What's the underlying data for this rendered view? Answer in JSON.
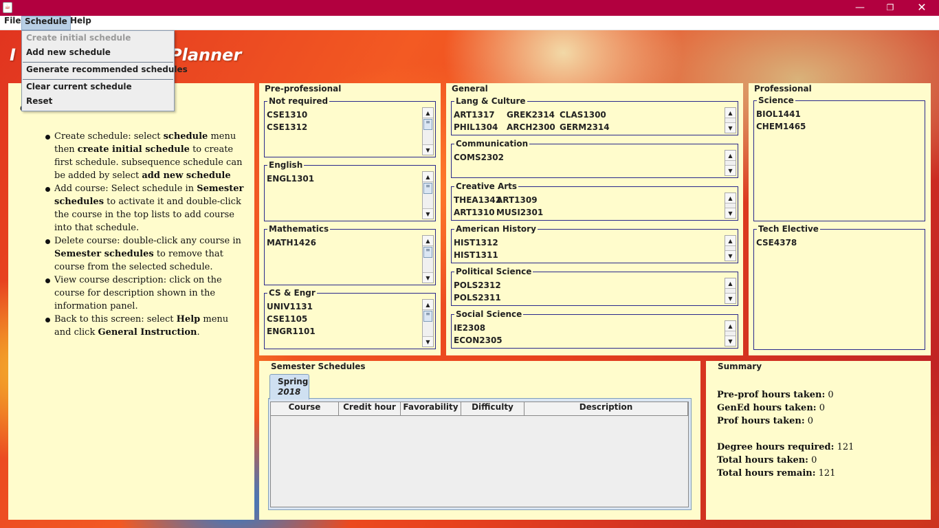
{
  "window": {
    "app_icon": "java-icon",
    "minimize_glyph": "—",
    "maximize_glyph": "❐",
    "close_glyph": "✕"
  },
  "menubar": {
    "file": "File",
    "schedule": "Schedule",
    "help": "Help"
  },
  "schedule_menu": {
    "create_initial": "Create initial schedule",
    "add_new": "Add new schedule",
    "generate_recommended": "Generate recommended schedules",
    "clear_current": "Clear current schedule",
    "reset": "Reset"
  },
  "banner": {
    "title_left": "I",
    "title_right": "Planner"
  },
  "instructions": {
    "heading": "General Instruction:",
    "items": [
      [
        "Create schedule: select ",
        "schedule",
        " menu then ",
        "create initial schedule",
        " to create first schedule. subsequence schedule can be added by select ",
        "add new schedule",
        ""
      ],
      [
        "Add course: Select schedule in ",
        "Semester schedules",
        " to activate it and double-click the course in the top lists to add course into that schedule.",
        "",
        "",
        "",
        ""
      ],
      [
        "Delete course: double-click any course in ",
        "Semester schedules",
        " to remove that course from the selected schedule.",
        "",
        "",
        "",
        ""
      ],
      [
        "View course description: click on the course for description shown in the information panel.",
        "",
        "",
        "",
        "",
        "",
        ""
      ],
      [
        "Back to this screen: select ",
        "Help",
        " menu and click ",
        "General Instruction",
        ".",
        "",
        ""
      ]
    ]
  },
  "preprofessional": {
    "title": "Pre-professional",
    "not_required": {
      "label": "Not required",
      "courses": [
        "CSE1310",
        "CSE1312"
      ]
    },
    "english": {
      "label": "English",
      "courses": [
        "ENGL1301"
      ]
    },
    "mathematics": {
      "label": "Mathematics",
      "courses": [
        "MATH1426"
      ]
    },
    "cs_engr": {
      "label": "CS & Engr",
      "courses": [
        "UNIV1131",
        "CSE1105",
        "ENGR1101"
      ]
    }
  },
  "general": {
    "title": "General",
    "lang_culture": {
      "label": "Lang & Culture",
      "rows": [
        [
          "ART1317",
          "GREK2314",
          "CLAS1300"
        ],
        [
          "PHIL1304",
          "ARCH2300",
          "GERM2314"
        ]
      ]
    },
    "communication": {
      "label": "Communication",
      "courses": [
        "COMS2302"
      ]
    },
    "creative_arts": {
      "label": "Creative Arts",
      "rows": [
        [
          "THEA1342",
          "ART1309"
        ],
        [
          "ART1310",
          "MUSI2301"
        ]
      ]
    },
    "american_history": {
      "label": "American History",
      "courses": [
        "HIST1312",
        "HIST1311"
      ]
    },
    "political_science": {
      "label": "Political Science",
      "courses": [
        "POLS2312",
        "POLS2311"
      ]
    },
    "social_science": {
      "label": "Social Science",
      "courses": [
        "IE2308",
        "ECON2305"
      ]
    }
  },
  "professional": {
    "title": "Professional",
    "science": {
      "label": "Science",
      "courses": [
        "BIOL1441",
        "CHEM1465"
      ]
    },
    "tech_elective": {
      "label": "Tech Elective",
      "courses": [
        "CSE4378"
      ]
    }
  },
  "semester": {
    "title": "Semester Schedules",
    "tab_term": "Spring",
    "tab_year": "2018",
    "columns": [
      "Course",
      "Credit hour",
      "Favorability",
      "Difficulty",
      "Description"
    ]
  },
  "summary": {
    "title": "Summary",
    "preprof_label": "Pre-prof hours taken:",
    "preprof_value": "0",
    "gened_label": "GenEd hours taken:",
    "gened_value": "0",
    "prof_label": "Prof hours taken:",
    "prof_value": "0",
    "degree_label": "Degree hours required:",
    "degree_value": "121",
    "total_taken_label": "Total hours taken:",
    "total_taken_value": "0",
    "total_remain_label": "Total hours remain:",
    "total_remain_value": "121"
  },
  "colors": {
    "titlebar": "#b2003f",
    "panel_background": "#fffccc",
    "group_border": "#27268a",
    "menu_highlight": "#b8cfe5"
  }
}
